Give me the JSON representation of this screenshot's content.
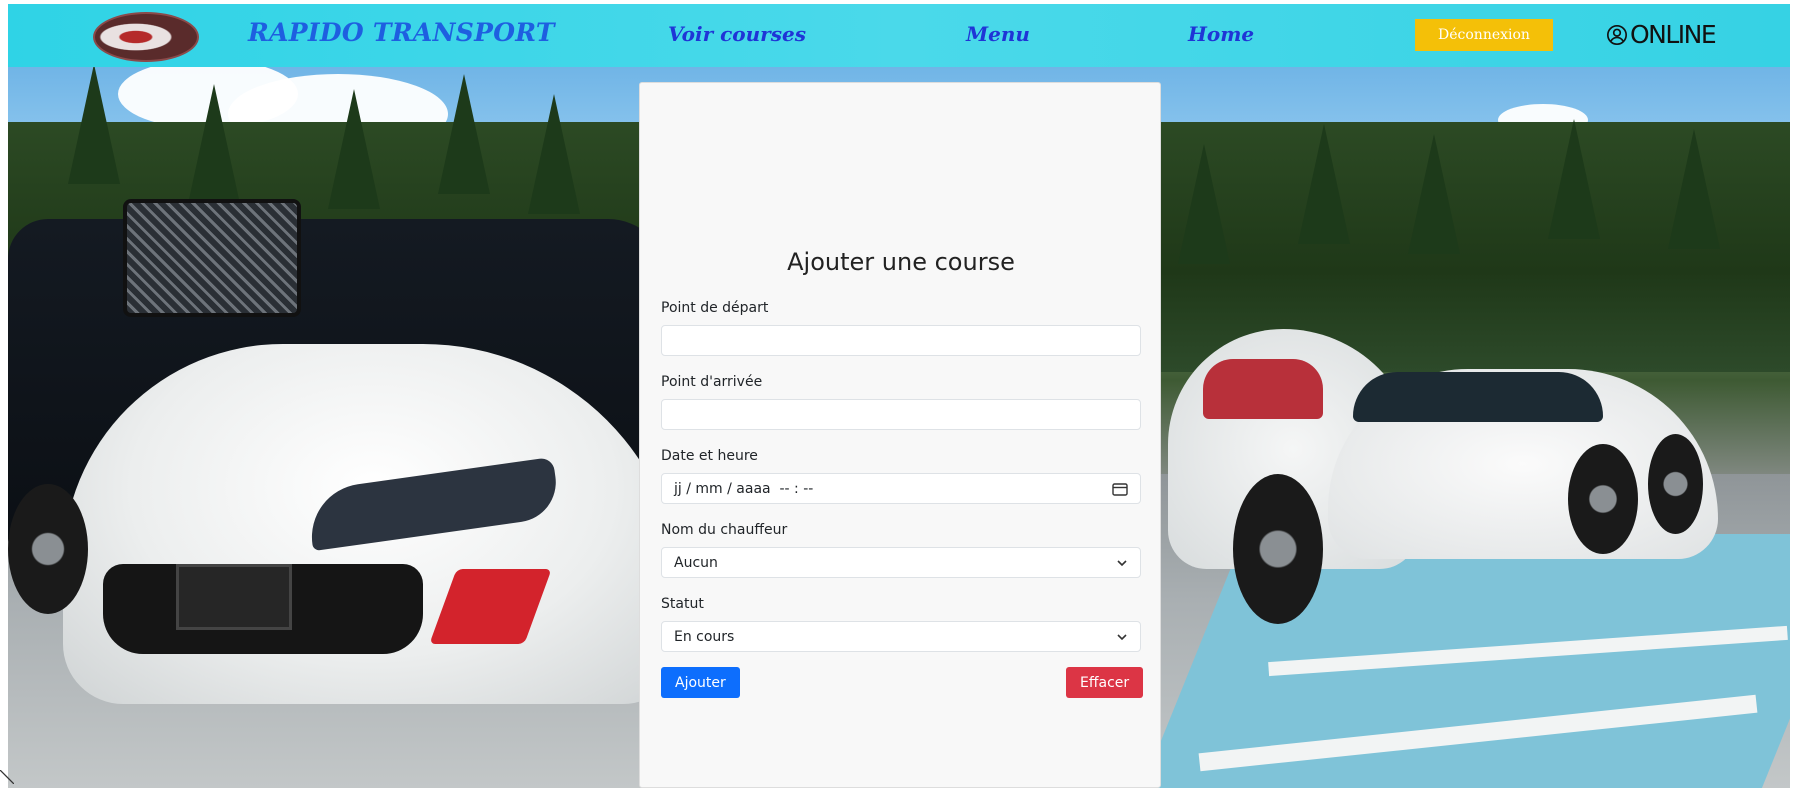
{
  "nav": {
    "brand": "RAPIDO TRANSPORT",
    "links": [
      "Voir courses",
      "Menu",
      "Home"
    ],
    "logout_label": "Déconnexion",
    "status_label": "ONLINE"
  },
  "form": {
    "title": "Ajouter une course",
    "fields": {
      "depart_label": "Point de départ",
      "depart_value": "",
      "arrivee_label": "Point d'arrivée",
      "arrivee_value": "",
      "date_label": "Date et heure",
      "date_placeholder": "jj / mm / aaaa  -- : --",
      "chauffeur_label": "Nom du chauffeur",
      "chauffeur_value": "Aucun",
      "statut_label": "Statut",
      "statut_value": "En cours"
    },
    "add_label": "Ajouter",
    "clear_label": "Effacer"
  },
  "colors": {
    "navbar": "#36d2e4",
    "brand_text": "#1e5fe0",
    "link_text": "#1f35d6",
    "logout_bg": "#f4c008",
    "add_bg": "#0d6efd",
    "clear_bg": "#dc3545",
    "card_bg": "#f8f8f8"
  },
  "icons": {
    "logo": "company-logo",
    "status": "user-circle-icon",
    "date": "calendar-icon",
    "select": "chevron-down-icon"
  }
}
